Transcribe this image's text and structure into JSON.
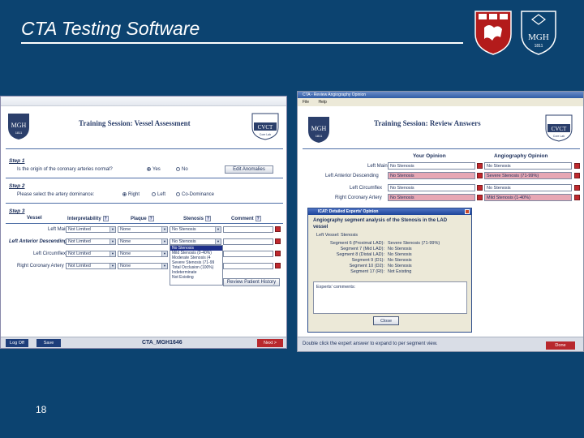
{
  "slide": {
    "title": "CTA Testing Software",
    "page_number": "18"
  },
  "logos": {
    "left_shield": "harvard-shield-icon",
    "right_shield": "mgh-shield-icon",
    "right_shield_text": "MGH",
    "right_shield_year": "1811"
  },
  "left_screen": {
    "badge_text": "MGH",
    "badge_year": "1811",
    "cvct_text": "CVCT",
    "cvct_sub": "Core Lab",
    "title": "Training Session: Vessel Assessment",
    "step1": {
      "label": "Step 1",
      "question": "Is the origin of the coronary arteries normal?",
      "opt_yes": "Yes",
      "opt_no": "No",
      "button": "Edit Anomalies"
    },
    "step2": {
      "label": "Step 2",
      "question": "Please select the artery dominance:",
      "opt_right": "Right",
      "opt_left": "Left",
      "opt_codom": "Co-Dominance"
    },
    "step3": {
      "label": "Step 3",
      "col_vessel": "Vessel",
      "col_interp": "Interpretability",
      "col_plaque": "Plaque",
      "col_stenosis": "Stenosis",
      "col_comment": "Comment",
      "help": "?",
      "rows": [
        {
          "vessel": "Left Main",
          "interp": "Not Limited",
          "plaque": "None",
          "stenosis": "No Stenosis"
        },
        {
          "vessel": "Left Anterior Descending",
          "interp": "Not Limited",
          "plaque": "None",
          "stenosis": "No Stenosis"
        },
        {
          "vessel": "Left Circumflex",
          "interp": "Not Limited",
          "plaque": "None",
          "stenosis": ""
        },
        {
          "vessel": "Right Coronary Artery",
          "interp": "Not Limited",
          "plaque": "None",
          "stenosis": ""
        }
      ],
      "dropdown_options": [
        "No Stenosis",
        "Mild Stenosis (0-40%)",
        "Moderate Stenosis (4",
        "Severe Stenosis (71-99",
        "Total Occlusion (100%)",
        "Indeterminate",
        "Not Existing"
      ],
      "history_button": "Review Patient History"
    },
    "footer": {
      "logoff": "Log Off",
      "save": "Save",
      "case_id": "CTA_MGH1646",
      "next": "Next >"
    }
  },
  "right_screen": {
    "window_title": "CTA - Review Angiography Opinion",
    "menu": [
      "File",
      "Help"
    ],
    "badge_text": "MGH",
    "badge_year": "1811",
    "cvct_text": "CVCT",
    "cvct_sub": "Core Lab",
    "title": "Training Session: Review Answers",
    "col_your": "Your Opinion",
    "col_angio": "Angiography Opinion",
    "rows": [
      {
        "vessel": "Left Main",
        "yours": "No Stenosis",
        "yours_style": "white",
        "angio": "No Stenosis",
        "angio_style": "white"
      },
      {
        "vessel": "Left Anterior Descending",
        "yours": "No Stenosis",
        "yours_style": "pink",
        "angio": "Severe Stenosis (71-99%)",
        "angio_style": "pink"
      },
      {
        "vessel": "Left Circumflex",
        "yours": "No Stenosis",
        "yours_style": "white",
        "angio": "No Stenosis",
        "angio_style": "white"
      },
      {
        "vessel": "Right Coronary Artery",
        "yours": "No Stenosis",
        "yours_style": "pink",
        "angio": "Mild Stenosis (1-40%)",
        "angio_style": "pink"
      }
    ],
    "dialog": {
      "title": "ICAT: Detailed Experts' Opinion",
      "heading_line1": "Angiography segment analysis of the Stenosis in the LAD",
      "heading_line2": "vessel",
      "vessel_line": "Left Vessel: Stenosis",
      "segments": [
        {
          "name": "Segment 6 (Proximal LAD):",
          "value": "Severe Stenosis (71-99%)"
        },
        {
          "name": "Segment 7 (Mid LAD):",
          "value": "No Stenosis"
        },
        {
          "name": "Segment 8 (Distal LAD):",
          "value": "No Stenosis"
        },
        {
          "name": "Segment 9 (D1):",
          "value": "No Stenosis"
        },
        {
          "name": "Segment 10 (D2):",
          "value": "No Stenosis"
        },
        {
          "name": "Segment 17 (RI):",
          "value": "Not Existing"
        }
      ],
      "comments_label": "Experts' comments:",
      "close_button": "Close"
    },
    "footer": {
      "hint": "Double click the expert answer to expand to per segment view.",
      "done": "Done"
    }
  },
  "colors": {
    "slide_bg": "#0c4370",
    "pink_cell": "#e7a7b4",
    "accent_red": "#b8282d",
    "nav_blue": "#1d3d7a"
  }
}
